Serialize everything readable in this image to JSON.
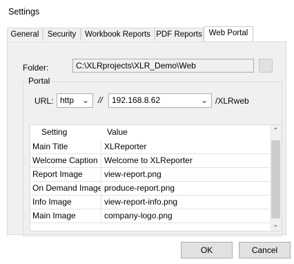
{
  "window": {
    "title": "Settings"
  },
  "tabs": [
    {
      "label": "General"
    },
    {
      "label": "Security"
    },
    {
      "label": "Workbook Reports"
    },
    {
      "label": "PDF Reports"
    },
    {
      "label": "Web Portal",
      "active": true
    }
  ],
  "folder": {
    "label": "Folder:",
    "value": "C:\\XLRprojects\\XLR_Demo\\Web"
  },
  "portal": {
    "legend": "Portal",
    "url_label": "URL:",
    "protocol": "http",
    "separator": "//",
    "host": "192.168.8.62",
    "path": "/XLRweb"
  },
  "grid": {
    "columns": [
      "Setting",
      "Value"
    ],
    "rows": [
      [
        "Main Title",
        "XLReporter"
      ],
      [
        "Welcome Caption",
        "Welcome to XLReporter"
      ],
      [
        "Report Image",
        "view-report.png"
      ],
      [
        "On Demand Image",
        "produce-report.png"
      ],
      [
        "Info Image",
        "view-report-info.png"
      ],
      [
        "Main Image",
        "company-logo.png"
      ]
    ]
  },
  "buttons": {
    "ok": "OK",
    "cancel": "Cancel"
  },
  "icons": {
    "dropdown": "chevron-down-icon",
    "scroll_up": "scroll-up-arrow-icon",
    "scroll_down": "scroll-down-arrow-icon"
  },
  "colors": {
    "panel": "#f0f0f0",
    "scroll_thumb": "#cdcdcd",
    "button": "#e1e1e1"
  }
}
